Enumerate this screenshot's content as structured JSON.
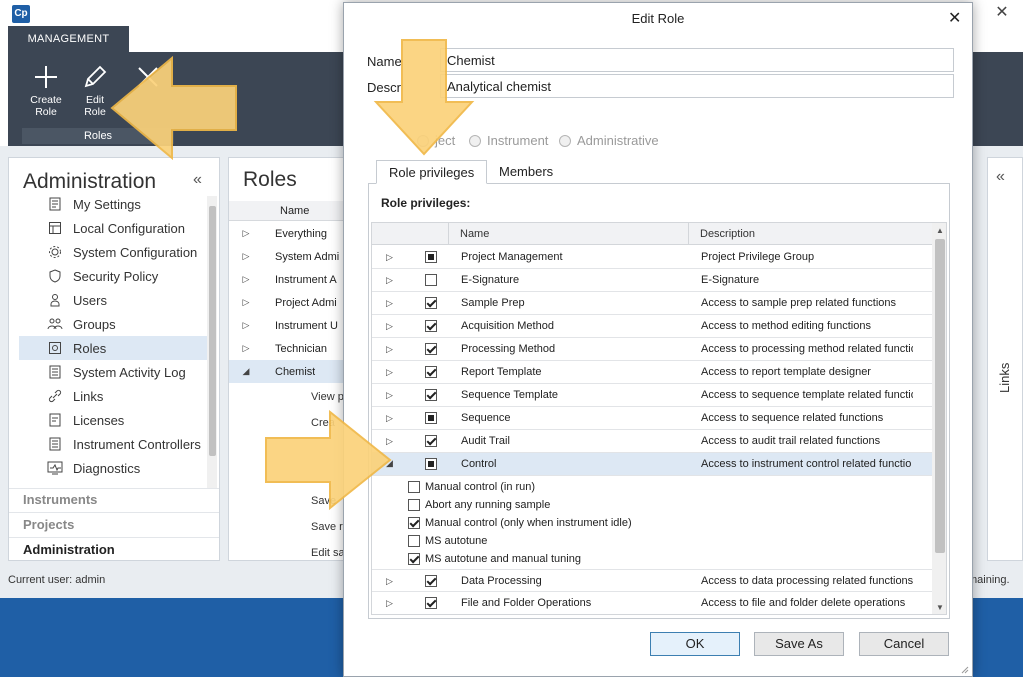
{
  "app": {
    "logo": "Cp",
    "close_glyph": "✕",
    "ribbon_tab": "MANAGEMENT",
    "ribbon_buttons": [
      {
        "label": "Create\nRole",
        "icon": "plus-icon"
      },
      {
        "label": "Edit\nRole",
        "icon": "pencil-icon"
      },
      {
        "label": "",
        "icon": "delete-x-icon"
      }
    ],
    "ribbon_group": "Roles"
  },
  "nav": {
    "title": "Administration",
    "collapse_glyph": "«",
    "items": [
      {
        "label": "My Settings",
        "icon": "settings-doc-icon"
      },
      {
        "label": "Local Configuration",
        "icon": "local-config-icon"
      },
      {
        "label": "System Configuration",
        "icon": "system-config-icon"
      },
      {
        "label": "Security Policy",
        "icon": "shield-icon"
      },
      {
        "label": "Users",
        "icon": "user-icon"
      },
      {
        "label": "Groups",
        "icon": "group-icon"
      },
      {
        "label": "Roles",
        "icon": "roles-icon",
        "selected": true
      },
      {
        "label": "System Activity Log",
        "icon": "log-icon"
      },
      {
        "label": "Links",
        "icon": "link-icon"
      },
      {
        "label": "Licenses",
        "icon": "license-icon"
      },
      {
        "label": "Instrument Controllers",
        "icon": "controller-icon"
      },
      {
        "label": "Diagnostics",
        "icon": "diagnostics-icon"
      }
    ],
    "sections": [
      "Instruments",
      "Projects",
      "Administration"
    ]
  },
  "roles_panel": {
    "title": "Roles",
    "header_name": "Name",
    "rows": [
      "Everything",
      "System Admi",
      "Instrument A",
      "Project Admi",
      "Instrument U",
      "Technician",
      "Chemist"
    ],
    "sub_rows": [
      "View p",
      "Crea",
      "Save",
      "Save re",
      "Edit sa"
    ]
  },
  "links_panel": {
    "label": "Links",
    "collapse_glyph": "«"
  },
  "status": {
    "user": "Current user: admin",
    "remaining": "maining."
  },
  "dialog": {
    "title": "Edit Role",
    "close_glyph": "✕",
    "name_label": "Name",
    "name_value": "Chemist",
    "desc_label": "Descr",
    "desc_value": "Analytical chemist",
    "radios": [
      "ject",
      "Instrument",
      "Administrative"
    ],
    "tabs": [
      "Role privileges",
      "Members"
    ],
    "privileges_heading": "Role privileges:",
    "grid_headers": {
      "name": "Name",
      "description": "Description"
    },
    "rows": [
      {
        "name": "Project Management",
        "description": "Project Privilege Group",
        "state": "partial"
      },
      {
        "name": "E-Signature",
        "description": "E-Signature",
        "state": "unchecked"
      },
      {
        "name": "Sample Prep",
        "description": "Access to sample prep related functions",
        "state": "checked"
      },
      {
        "name": "Acquisition Method",
        "description": "Access to method editing functions",
        "state": "checked"
      },
      {
        "name": "Processing Method",
        "description": "Access to processing method related functio",
        "state": "checked"
      },
      {
        "name": "Report Template",
        "description": "Access to report template designer",
        "state": "checked"
      },
      {
        "name": "Sequence Template",
        "description": "Access to sequence template related functio",
        "state": "checked"
      },
      {
        "name": "Sequence",
        "description": "Access to sequence related functions",
        "state": "partial"
      },
      {
        "name": "Audit Trail",
        "description": "Access to audit trail related functions",
        "state": "checked"
      },
      {
        "name": "Control",
        "description": "Access to instrument control related functio",
        "state": "partial",
        "expanded": true
      }
    ],
    "control_subitems": [
      {
        "label": "Manual control (in run)",
        "checked": false
      },
      {
        "label": "Abort any running sample",
        "checked": false
      },
      {
        "label": "Manual control (only when instrument idle)",
        "checked": true
      },
      {
        "label": "MS autotune",
        "checked": false
      },
      {
        "label": "MS autotune and manual tuning",
        "checked": true
      }
    ],
    "rows_after": [
      {
        "name": "Data Processing",
        "description": "Access to data processing related functions",
        "state": "checked"
      },
      {
        "name": "File and Folder Operations",
        "description": "Access to file and folder delete operations",
        "state": "checked"
      }
    ],
    "buttons": {
      "ok": "OK",
      "save_as": "Save As",
      "cancel": "Cancel"
    }
  },
  "colors": {
    "accent": "#1f5fa6",
    "ribbon": "#3c4654",
    "arrow": "#fbd27a",
    "selection": "#dde8f4"
  }
}
